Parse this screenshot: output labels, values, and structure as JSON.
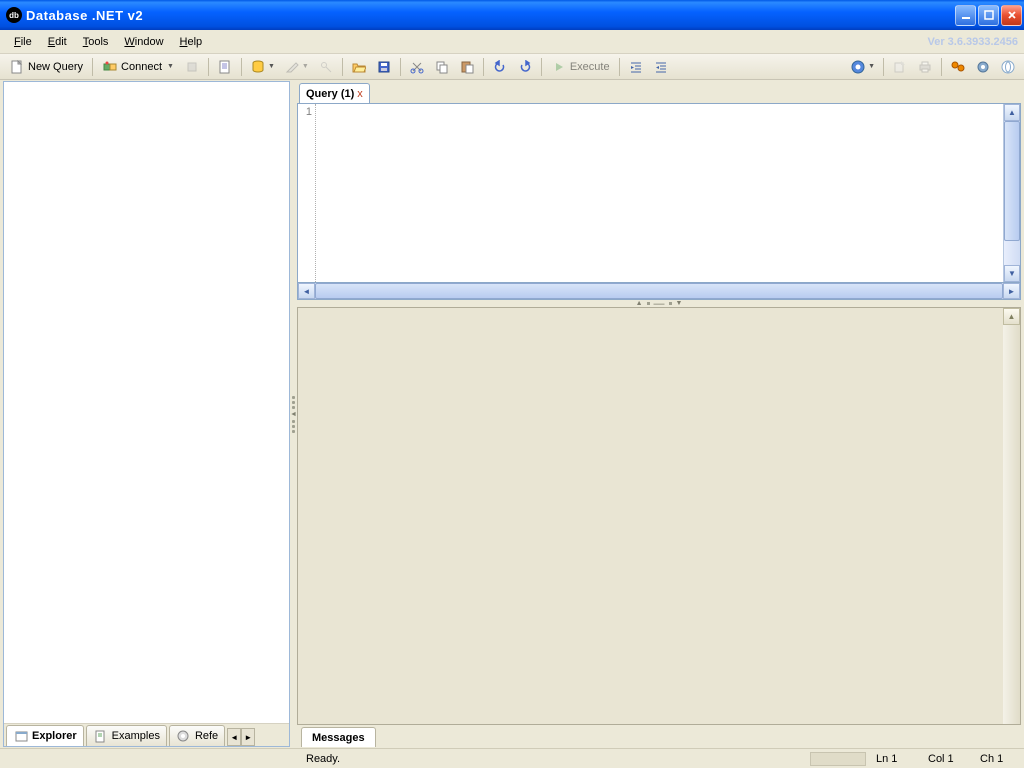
{
  "titlebar": {
    "title": "Database .NET v2"
  },
  "menubar": {
    "file": "File",
    "edit": "Edit",
    "tools": "Tools",
    "window": "Window",
    "help": "Help",
    "version": "Ver 3.6.3933.2456"
  },
  "toolbar": {
    "new_query": "New Query",
    "connect": "Connect",
    "execute": "Execute"
  },
  "left_tabs": {
    "explorer": "Explorer",
    "examples": "Examples",
    "reference": "Refe"
  },
  "editor": {
    "tab_label": "Query (1)",
    "line_number": "1"
  },
  "messages_tab": "Messages",
  "status": {
    "ready": "Ready.",
    "line": "Ln 1",
    "col": "Col 1",
    "ch": "Ch 1"
  }
}
